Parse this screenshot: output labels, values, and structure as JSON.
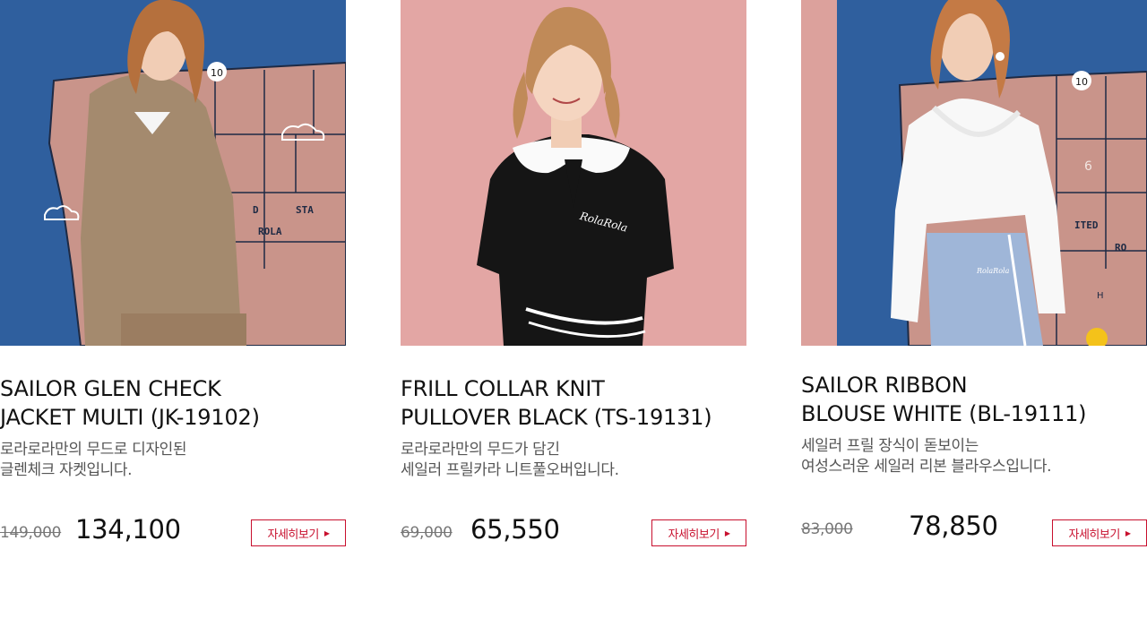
{
  "products": [
    {
      "title_line1": "SAILOR GLEN CHECK",
      "title_line2": "JACKET MULTI (JK-19102)",
      "desc_line1": "로라로라만의 무드로 디자인된",
      "desc_line2": "글렌체크 자켓입니다.",
      "old_price": "149,000",
      "price": "134,100",
      "button_label": "자세히보기",
      "map_labels": [
        "10",
        "D",
        "STA",
        "ROLA"
      ]
    },
    {
      "title_line1": "FRILL COLLAR KNIT",
      "title_line2": "PULLOVER BLACK (TS-19131)",
      "desc_line1": "로라로라만의 무드가 담긴",
      "desc_line2": "세일러 프릴카라 니트풀오버입니다.",
      "old_price": "69,000",
      "price": "65,550",
      "button_label": "자세히보기",
      "logo_text": "RolaRola"
    },
    {
      "title_line1": "SAILOR RIBBON",
      "title_line2": "BLOUSE WHITE (BL-19111)",
      "desc_line1": "세일러 프릴 장식이 돋보이는",
      "desc_line2": "여성스러운 세일러 리본 블라우스입니다.",
      "old_price": "83,000",
      "price": "78,850",
      "button_label": "자세히보기",
      "map_labels": [
        "10",
        "6",
        "ITED",
        "RO",
        "H"
      ],
      "logo_text": "RolaRola"
    }
  ],
  "colors": {
    "accent": "#c8102e",
    "map_blue": "#2f5f9e",
    "map_pink": "#c9948a",
    "wall_pink": "#e6a9a6"
  }
}
